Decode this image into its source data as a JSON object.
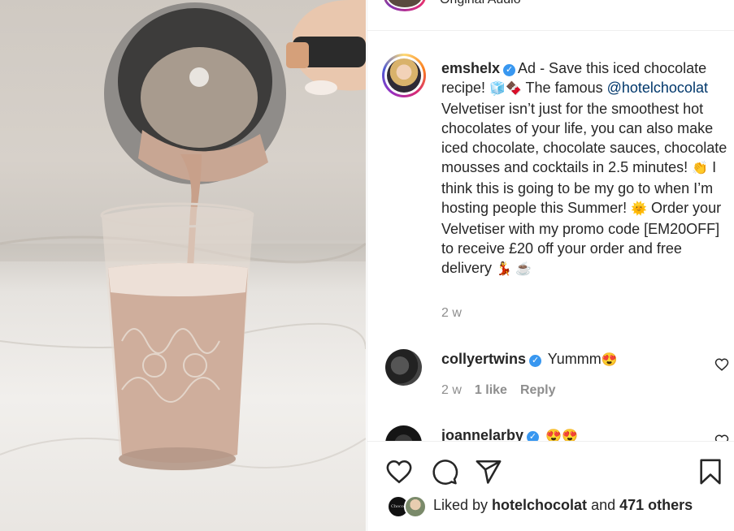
{
  "header": {
    "audio_label": "Original Audio"
  },
  "post": {
    "username": "emshelx",
    "caption_part1": "Ad - Save this iced chocolate recipe! ",
    "emoji1": "🧊🍫",
    "caption_part2": " The famous ",
    "mention": "@hotelchocolat",
    "caption_part3": " Velvetiser isn’t just for the smoothest hot chocolates of your life, you can also make iced chocolate, chocolate sauces, chocolate mousses and cocktails in 2.5 minutes! ",
    "emoji2": "👏",
    "caption_part4": " I think this is going to be my go to when I’m hosting people this Summer! ",
    "emoji3": "🌞",
    "caption_part5": " Order your Velvetiser with my promo code [EM20OFF] to receive £20 off your order and free delivery ",
    "emoji4": "💃 ☕",
    "time": "2 w"
  },
  "comments": [
    {
      "username": "collyertwins",
      "text": " Yummm",
      "emoji": "😍",
      "time": "2 w",
      "likes": "1 like",
      "reply": "Reply"
    },
    {
      "username": "joannelarby",
      "text": " ",
      "emoji": "😍😍"
    }
  ],
  "likes": {
    "avatar1_label": "Chocolat",
    "prefix": "Liked by ",
    "user": "hotelchocolat",
    "middle": " and ",
    "count": "471 others"
  },
  "icons": {
    "like": "heart-icon",
    "comment": "comment-icon",
    "share": "share-icon",
    "save": "bookmark-icon"
  }
}
